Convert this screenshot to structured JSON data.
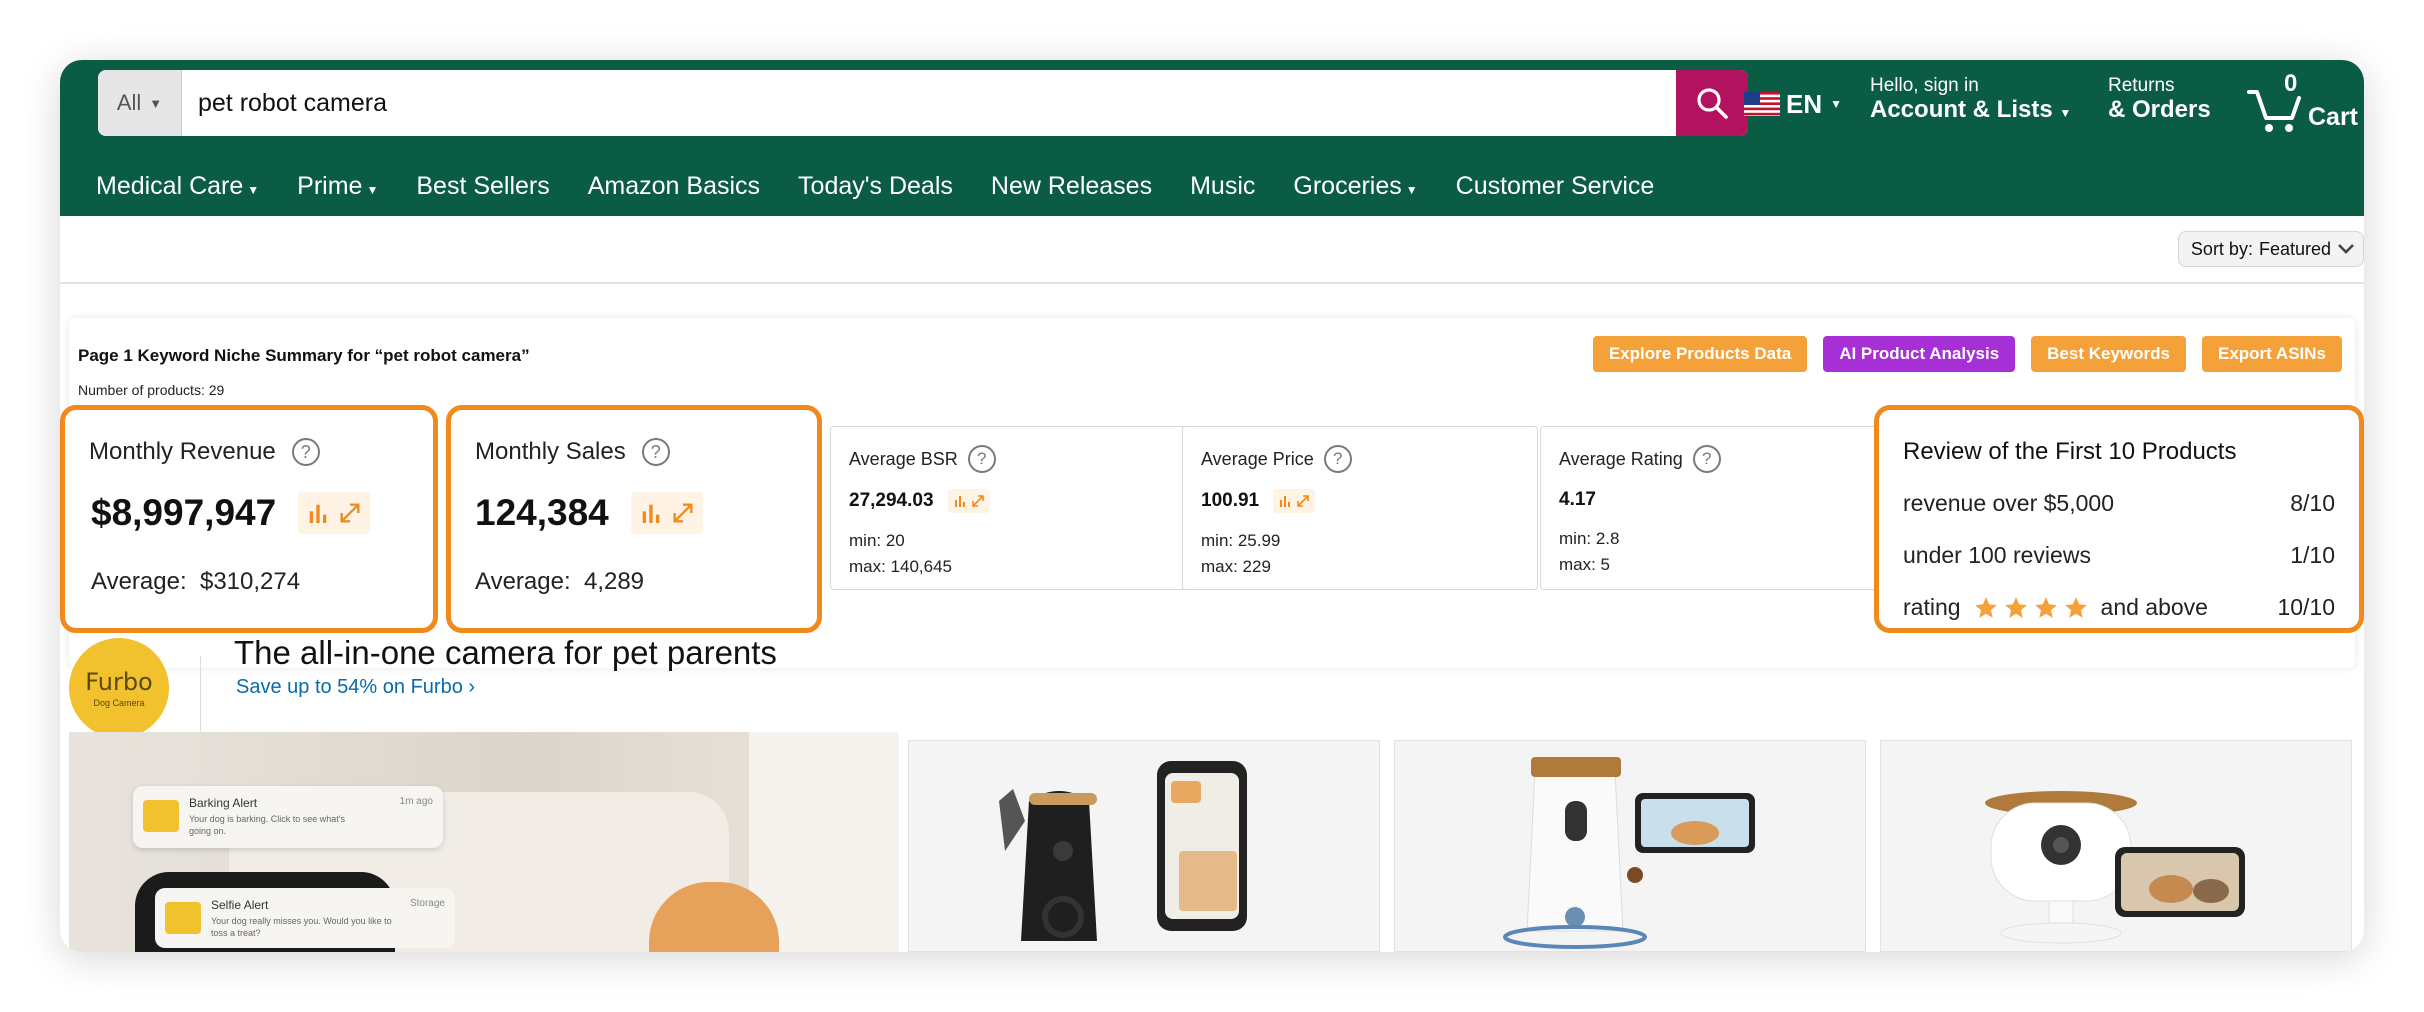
{
  "search": {
    "category": "All",
    "query": "pet robot camera"
  },
  "header": {
    "language": "EN",
    "account_line1": "Hello, sign in",
    "account_line2": "Account & Lists",
    "orders_line1": "Returns",
    "orders_line2": "& Orders",
    "cart_count": "0",
    "cart_label": "Cart"
  },
  "nav": [
    {
      "label": "Medical Care",
      "dropdown": true
    },
    {
      "label": "Prime",
      "dropdown": true
    },
    {
      "label": "Best Sellers",
      "dropdown": false
    },
    {
      "label": "Amazon Basics",
      "dropdown": false
    },
    {
      "label": "Today's Deals",
      "dropdown": false
    },
    {
      "label": "New Releases",
      "dropdown": false
    },
    {
      "label": "Music",
      "dropdown": false
    },
    {
      "label": "Groceries",
      "dropdown": true
    },
    {
      "label": "Customer Service",
      "dropdown": false
    }
  ],
  "sort": {
    "label": "Sort by:",
    "value": "Featured"
  },
  "summary": {
    "title": "Page 1 Keyword Niche Summary for “pet robot camera”",
    "num_products": "Number of products: 29",
    "actions": [
      {
        "label": "Explore Products Data",
        "color": "#f5a13a"
      },
      {
        "label": "AI Product Analysis",
        "color": "#a62fd6"
      },
      {
        "label": "Best Keywords",
        "color": "#f5a13a"
      },
      {
        "label": "Export ASINs",
        "color": "#f5a13a"
      }
    ],
    "revenue": {
      "label": "Monthly Revenue",
      "value": "$8,997,947",
      "avg_label": "Average:",
      "avg_value": "$310,274"
    },
    "sales": {
      "label": "Monthly Sales",
      "value": "124,384",
      "avg_label": "Average:",
      "avg_value": "4,289"
    },
    "bsr": {
      "label": "Average BSR",
      "value": "27,294.03",
      "min": "min: 20",
      "max": "max: 140,645"
    },
    "price": {
      "label": "Average Price",
      "value": "100.91",
      "min": "min: 25.99",
      "max": "max: 229"
    },
    "rating": {
      "label": "Average Rating",
      "value": "4.17",
      "min": "min: 2.8",
      "max": "max: 5"
    },
    "review": {
      "title": "Review of the First 10 Products",
      "rows": [
        {
          "label": "revenue over $5,000",
          "value": "8/10"
        },
        {
          "label": "under 100 reviews",
          "value": "1/10"
        },
        {
          "label_before": "rating",
          "stars": 4,
          "label_after": "and above",
          "value": "10/10"
        }
      ]
    }
  },
  "banner": {
    "logo_text": "Furbo",
    "logo_sub": "Dog Camera",
    "title": "The all-in-one camera for pet parents",
    "link": "Save up to 54% on Furbo ›"
  },
  "hero_tile": {
    "alert1_title": "Barking Alert",
    "alert1_time": "1m ago",
    "alert1_text": "Your dog is barking. Click to see what's going on.",
    "alert2_title": "Selfie Alert",
    "alert2_time": "Storage",
    "alert2_text": "Your dog really misses you. Would you like to toss a treat?"
  },
  "colors": {
    "header_bg": "#0b5c44",
    "search_btn": "#b3125f",
    "highlight": "#f08a1c",
    "star": "#f5a13a"
  }
}
